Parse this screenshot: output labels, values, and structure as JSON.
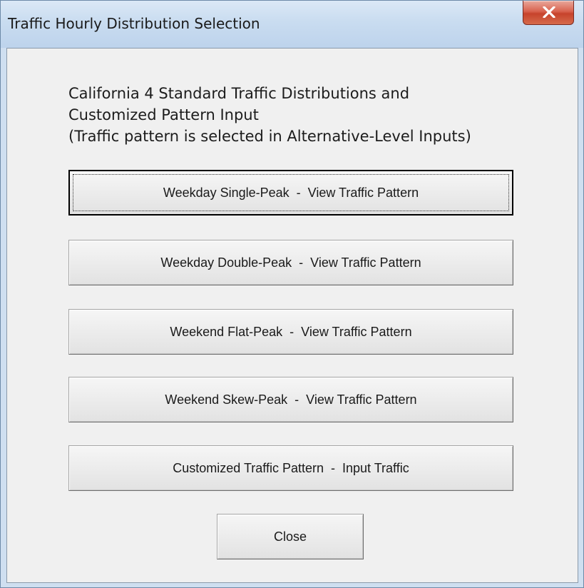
{
  "window": {
    "title": "Traffic Hourly Distribution Selection",
    "close_icon": "close-x-icon"
  },
  "description": {
    "line1": "California 4 Standard Traffic Distributions and",
    "line2": "Customized Pattern Input",
    "line3": "(Traffic pattern is selected in Alternative-Level Inputs)"
  },
  "buttons": [
    {
      "label": "Weekday Single-Peak  -  View Traffic Pattern",
      "focused": true
    },
    {
      "label": "Weekday Double-Peak  -  View Traffic Pattern",
      "focused": false
    },
    {
      "label": "Weekend Flat-Peak  -  View Traffic Pattern",
      "focused": false
    },
    {
      "label": "Weekend Skew-Peak  -  View Traffic Pattern",
      "focused": false
    },
    {
      "label": "Customized Traffic Pattern  -  Input Traffic",
      "focused": false
    }
  ],
  "close_button": {
    "label": "Close"
  }
}
